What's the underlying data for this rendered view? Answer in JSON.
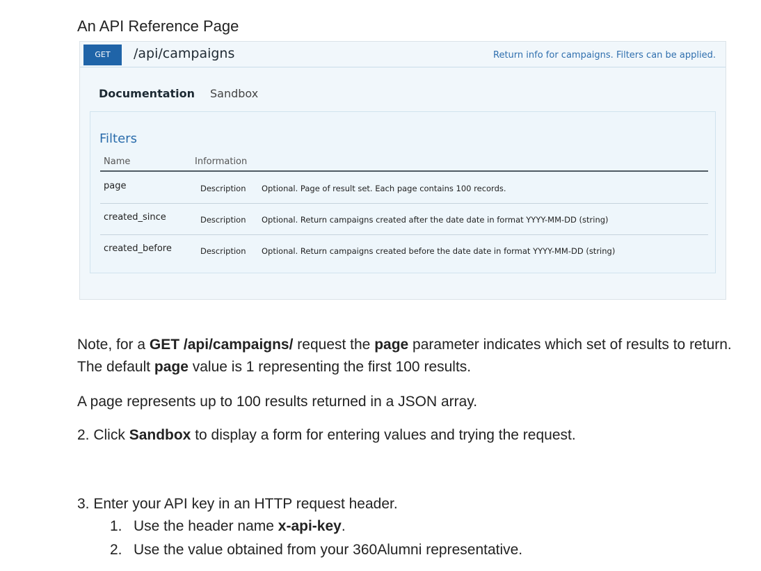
{
  "heading": "An API Reference Page",
  "api": {
    "method": "GET",
    "path": "/api/campaigns",
    "summary": "Return info for campaigns. Filters can be applied.",
    "tabs": [
      "Documentation",
      "Sandbox"
    ],
    "active_tab": "Documentation",
    "filters": {
      "title": "Filters",
      "columns": [
        "Name",
        "Information"
      ],
      "rows": [
        {
          "name": "page",
          "label": "Description",
          "text": "Optional. Page of result set. Each page contains 100 records."
        },
        {
          "name": "created_since",
          "label": "Description",
          "text": "Optional. Return campaigns created after the date date in format YYYY-MM-DD (string)"
        },
        {
          "name": "created_before",
          "label": "Description",
          "text": "Optional. Return campaigns created before the date date in format YYYY-MM-DD (string)"
        }
      ]
    }
  },
  "note": {
    "p1_a": "Note, for a ",
    "p1_b": "GET /api/campaigns/",
    "p1_c": " request the ",
    "p1_d": "page",
    "p1_e": " parameter indicates which set of results to return. The default ",
    "p1_f": "page",
    "p1_g": " value is 1 representing the first 100 results.",
    "p2": "A page represents up to 100 results returned in a JSON array.",
    "p3_a": "2. Click ",
    "p3_b": "Sandbox",
    "p3_c": " to display a form for entering values and trying the request.",
    "p4": "3. Enter your API key in an HTTP request header.",
    "sub1_num": "1.",
    "sub1_a": "Use the header name ",
    "sub1_b": "x-api-key",
    "sub1_c": ".",
    "sub2_num": "2.",
    "sub2": "Use the value obtained from your 360Alumni representative."
  }
}
